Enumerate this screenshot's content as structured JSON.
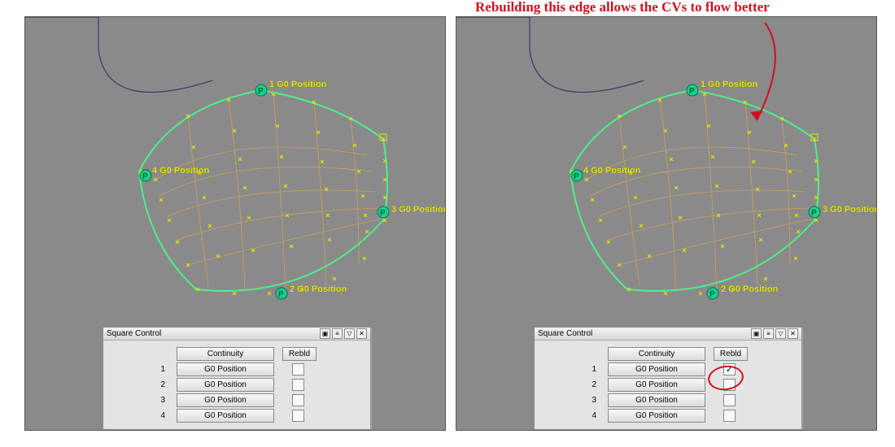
{
  "annotation": "Rebuilding this edge allows the CVs to flow better",
  "edgeLabels": {
    "one": "1 G0 Position",
    "two": "2 G0 Position",
    "three": "3 G0 Position",
    "four": "4 G0 Position"
  },
  "handleGlyph": "P",
  "panel": {
    "title": "Square Control",
    "continuityHeader": "Continuity",
    "rebldHeader": "Rebld",
    "rows": [
      {
        "num": "1",
        "label": "G0 Position",
        "checked": false
      },
      {
        "num": "2",
        "label": "G0 Position",
        "checked": false
      },
      {
        "num": "3",
        "label": "G0 Position",
        "checked": false
      },
      {
        "num": "4",
        "label": "G0 Position",
        "checked": false
      }
    ],
    "rowsRight": [
      {
        "num": "1",
        "label": "G0 Position",
        "checked": true
      },
      {
        "num": "2",
        "label": "G0 Position",
        "checked": false
      },
      {
        "num": "3",
        "label": "G0 Position",
        "checked": false
      },
      {
        "num": "4",
        "label": "G0 Position",
        "checked": false
      }
    ]
  },
  "colors": {
    "boundary": "#4cf08a",
    "iso": "#d0a060",
    "cv": "#e6e600",
    "handle": "#18d18f",
    "annotation": "#d01020"
  }
}
